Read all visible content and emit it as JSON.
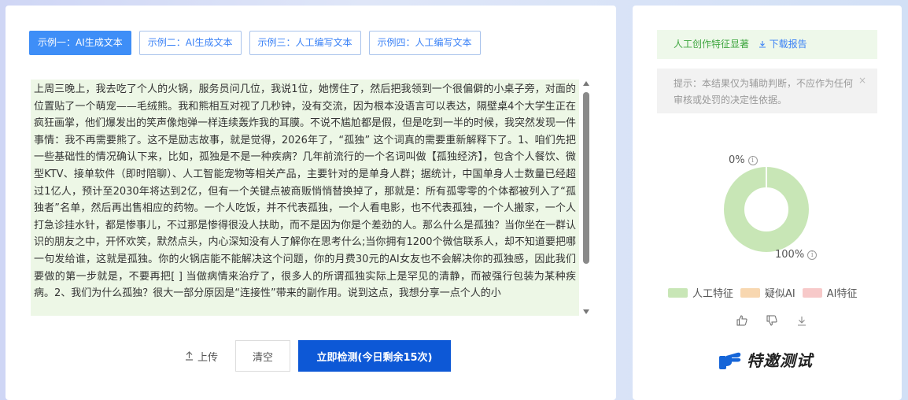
{
  "tabs": [
    {
      "label": "示例一：AI生成文本"
    },
    {
      "label": "示例二：AI生成文本"
    },
    {
      "label": "示例三：人工编写文本"
    },
    {
      "label": "示例四：人工编写文本"
    }
  ],
  "editor": {
    "text": "上周三晚上，我去吃了个人的火锅，服务员问几位，我说1位，她愣住了，然后把我领到一个很偏僻的小桌子旁，对面的位置贴了一个萌宠——毛绒熊。我和熊相互对视了几秒钟，没有交流，因为根本没语言可以表达，隔壁桌4个大学生正在疯狂画掌，他们爆发出的笑声像炮弹一样连续轰炸我的耳膜。不说不尴尬都是假，但是吃到一半的时候，我突然发现一件事情：我不再需要熊了。这不是励志故事，就是觉得，2026年了，“孤独” 这个词真的需要重新解释下了。1、咱们先把一些基础性的情况确认下来，比如，孤独是不是一种疾病？几年前流行的一个名词叫做【孤独经济】，包含个人餐饮、微型KTV、接单软件（即时陪聊）、人工智能宠物等相关产品，主要针对的是单身人群；据统计，中国单身人士数量已经超过1亿人，预计至2030年将达到2亿，但有一个关键点被商贩悄悄替换掉了，那就是：所有孤零零的个体都被列入了“孤独者”名单，然后再出售相应的药物。一个人吃饭，并不代表孤独，一个人看电影，也不代表孤独，一个人搬家，一个人打急诊挂水针，都是惨事儿，不过那是惨得很没人扶助，而不是因为你是个差劲的人。那么什么是孤独？当你坐在一群认识的朋友之中，开怀欢笑，默然点头，内心深知没有人了解你在思考什么;当你拥有1200个微信联系人，却不知道要把哪一句发给谁，这就是孤独。你的火锅店能不能解决这个问题，你的月费30元的AI女友也不会解决你的孤独感，因此我们要做的第一步就是，不要再把[ ] 当做病情来治疗了，很多人的所谓孤独实际上是罕见的清静，而被强行包装为某种疾病。2、我们为什么孤独？很大一部分原因是“连接性”带来的副作用。说到这点，我想分享一点个人的小"
  },
  "actions": {
    "upload_label": "上传",
    "clear_label": "清空",
    "detect_label": "立即检测(今日剩余15次)"
  },
  "result": {
    "status": "人工创作特征显著",
    "download_label": "下载报告",
    "hint": "提示：本结果仅为辅助判断，不应作为任何审核或处罚的决定性依据。",
    "close_glyph": "×"
  },
  "chart_data": {
    "type": "pie",
    "style": "donut",
    "series": [
      {
        "name": "人工特征",
        "value": 100,
        "color": "#c8e6b6"
      },
      {
        "name": "疑似AI",
        "value": 0,
        "color": "#f8d7b0"
      },
      {
        "name": "AI特征",
        "value": 0,
        "color": "#f7c9c9"
      }
    ],
    "labels": {
      "top": "0%",
      "bottom": "100%"
    }
  },
  "legend": [
    {
      "label": "人工特征",
      "color": "#c8e6b6"
    },
    {
      "label": "疑似AI",
      "color": "#f8d7b0"
    },
    {
      "label": "AI特征",
      "color": "#f7c9c9"
    }
  ],
  "brand": {
    "text": "特邀测试",
    "color": "#1565d8"
  }
}
